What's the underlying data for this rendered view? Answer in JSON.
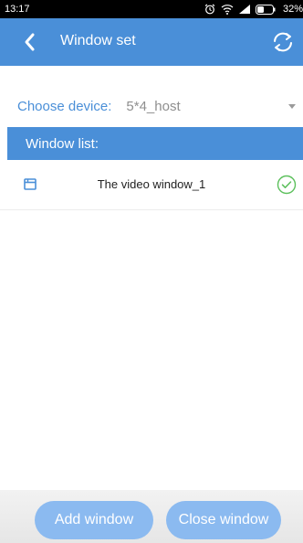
{
  "status_bar": {
    "time": "13:17",
    "battery": "32%"
  },
  "app_bar": {
    "title": "Window set",
    "back_icon": "back-arrow-icon",
    "refresh_icon": "refresh-icon"
  },
  "device": {
    "label": "Choose device:",
    "value": "5*4_host"
  },
  "window_list": {
    "header": "Window list:",
    "items": [
      {
        "name": "The video window_1",
        "selected": true
      }
    ]
  },
  "actions": {
    "add_label": "Add window",
    "close_label": "Close window"
  },
  "colors": {
    "primary": "#4a8fd8",
    "button": "#8bbaf0",
    "check": "#5cc05c"
  }
}
